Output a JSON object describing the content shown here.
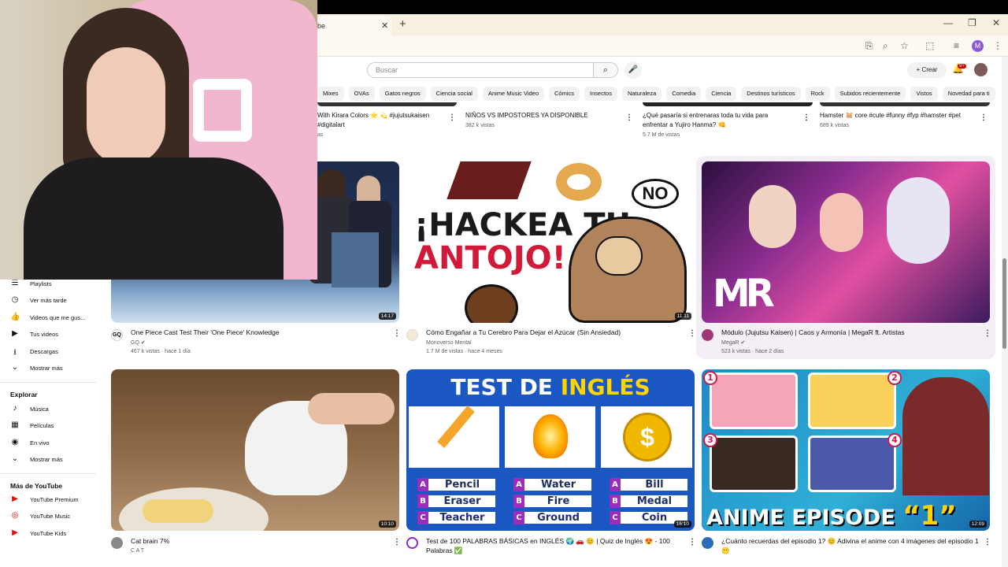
{
  "browser": {
    "tab_title": "be",
    "new_tab": "+",
    "profile_letter": "M"
  },
  "header": {
    "search_placeholder": "Buscar",
    "create_label": "Crear",
    "notif_badge": "9+"
  },
  "chips": [
    "Mixes",
    "OVAs",
    "Gatos negros",
    "Ciencia social",
    "Anime Music Video",
    "Cómics",
    "Insectos",
    "Naturaleza",
    "Comedia",
    "Ciencia",
    "Destinos turísticos",
    "Rock",
    "Subidos recientemente",
    "Vistos",
    "Novedad para ti"
  ],
  "previous_row": [
    {
      "title1": "With Kirara Colors ⭐ 💫 #jujutsukaisen",
      "title2": "#digitalart",
      "meta": "as"
    },
    {
      "title1": "NIÑOS VS IMPOSTORES YA DISPONIBLE",
      "title2": "",
      "meta": "382 k vistas"
    },
    {
      "title1": "¿Qué pasaría si entrenaras toda tu vida para",
      "title2": "enfrentar a Yujiro Hanma? 👊",
      "meta": "5.7 M de vistas"
    },
    {
      "title1": "Hamster 🐹 core #cute #funny #fyp #hamster #pet",
      "title2": "",
      "meta": "689 k vistas"
    }
  ],
  "videos": [
    {
      "title": "One Piece Cast Test Their 'One Piece' Knowledge",
      "title2": "",
      "channel": "GQ",
      "stats": "467 k vistas · hace 1 día",
      "duration": "14:17"
    },
    {
      "title": "Cómo Engañar a Tu Cerebro Para Dejar el Azúcar (Sin Ansiedad)",
      "title2": "",
      "channel": "Monoverso Mental",
      "stats": "1.7 M de vistas · hace 4 meses",
      "duration": "11:11"
    },
    {
      "title": "Módulo (Jujutsu Kaisen) | Caos y Armonía | MegaR ft. Artistas",
      "title2": "",
      "channel": "MegaR",
      "stats": "523 k vistas · hace 2 días",
      "duration": ""
    },
    {
      "title": "Cat brain 7%",
      "title2": "",
      "channel": "C A T",
      "stats": "",
      "duration": "10:10"
    },
    {
      "title": "Test de 100 PALABRAS BÁSICAS en INGLÉS 🌍 🚗 😊 | Quiz de Inglés 😍 - 100",
      "title2": "Palabras ✅",
      "channel": "",
      "stats": "",
      "duration": "16:10"
    },
    {
      "title": "¿Cuánto recuerdas del episodio 1? 😊 Adivina el anime con 4 imágenes del episodio 1",
      "title2": "😶",
      "channel": "",
      "stats": "",
      "duration": "12:09"
    }
  ],
  "thumb_text": {
    "hackea1": "¡HACKEA TU",
    "hackea2": "ANTOJO!",
    "no": "NO",
    "mr_logo": "MR",
    "test_title_a": "TEST DE ",
    "test_title_b": "INGLÉS",
    "test_options": [
      [
        {
          "l": "A",
          "w": "Pencil"
        },
        {
          "l": "B",
          "w": "Eraser"
        },
        {
          "l": "C",
          "w": "Teacher"
        }
      ],
      [
        {
          "l": "A",
          "w": "Water"
        },
        {
          "l": "B",
          "w": "Fire"
        },
        {
          "l": "C",
          "w": "Ground"
        }
      ],
      [
        {
          "l": "A",
          "w": "Bill"
        },
        {
          "l": "B",
          "w": "Medal"
        },
        {
          "l": "C",
          "w": "Coin"
        }
      ]
    ],
    "anime_ep": "ANIME EPISODE",
    "anime_one": "“1”",
    "nums": [
      "1",
      "2",
      "3",
      "4"
    ]
  },
  "sidebar": {
    "items_top": [
      {
        "label": "Playlists",
        "icon": "playlist-icon"
      },
      {
        "label": "Ver más tarde",
        "icon": "clock-icon"
      },
      {
        "label": "Videos que me gus...",
        "icon": "thumbs-up-icon"
      },
      {
        "label": "Tus videos",
        "icon": "video-icon"
      },
      {
        "label": "Descargas",
        "icon": "download-icon"
      },
      {
        "label": "Mostrar más",
        "icon": "chevron-down-icon"
      }
    ],
    "explore_heading": "Explorar",
    "explore_items": [
      {
        "label": "Música",
        "icon": "music-icon"
      },
      {
        "label": "Películas",
        "icon": "film-icon"
      },
      {
        "label": "En vivo",
        "icon": "live-icon"
      },
      {
        "label": "Mostrar más",
        "icon": "chevron-down-icon"
      }
    ],
    "more_heading": "Más de YouTube",
    "more_items": [
      {
        "label": "YouTube Premium",
        "icon": "youtube-premium-icon"
      },
      {
        "label": "YouTube Music",
        "icon": "youtube-music-icon"
      },
      {
        "label": "YouTube Kids",
        "icon": "youtube-kids-icon"
      }
    ]
  },
  "colors": {
    "brand_red": "#ff0000",
    "test_blue": "#1a57c2",
    "test_yellow": "#ffd400",
    "highlight": "#f4eef6"
  }
}
